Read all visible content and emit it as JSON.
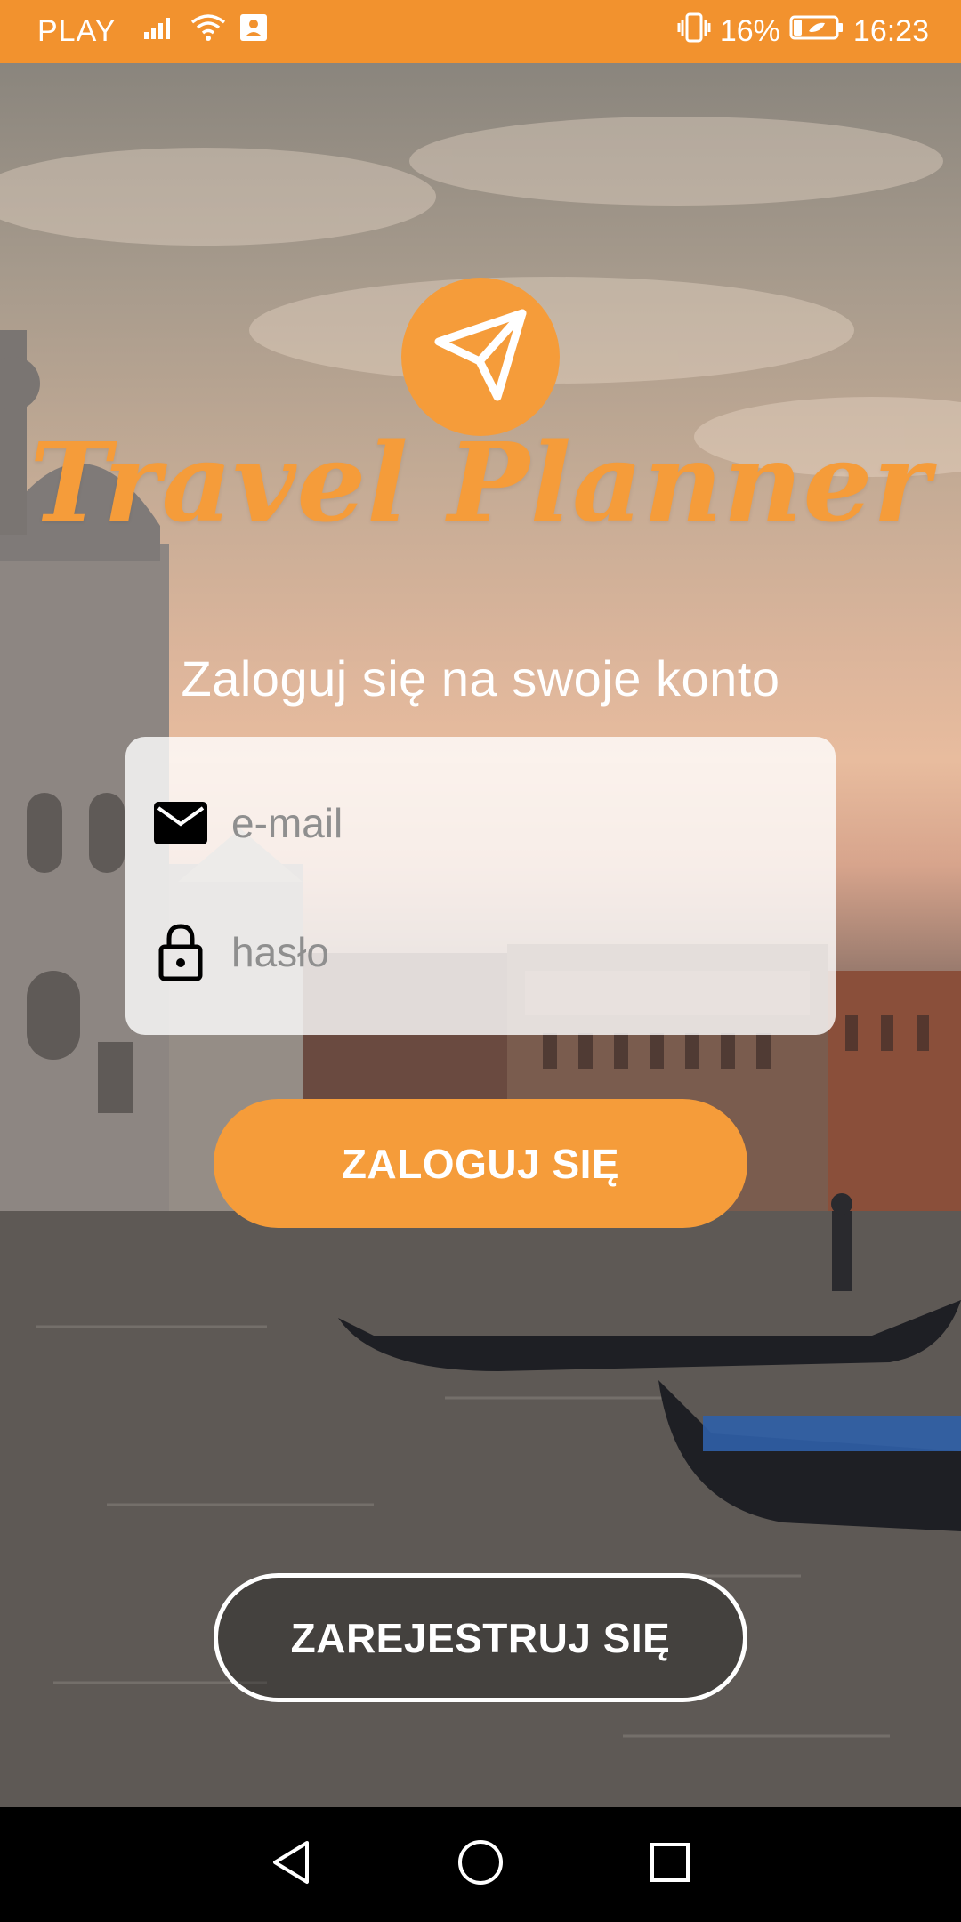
{
  "status_bar": {
    "carrier": "PLAY",
    "battery_percent": "16%",
    "time": "16:23",
    "icons": [
      "signal-icon",
      "wifi-icon",
      "contact-card-icon",
      "vibrate-icon",
      "battery-icon"
    ]
  },
  "app": {
    "title": "Travel Planner",
    "logo_icon": "paper-plane-icon",
    "brand_color": "#f59c3a"
  },
  "login": {
    "heading": "Zaloguj się na swoje konto",
    "email_placeholder": "e-mail",
    "password_placeholder": "hasło",
    "login_button": "ZALOGUJ SIĘ",
    "register_button": "ZAREJESTRUJ SIĘ"
  },
  "nav_bar": {
    "icons": [
      "back-icon",
      "home-icon",
      "recents-icon"
    ]
  }
}
